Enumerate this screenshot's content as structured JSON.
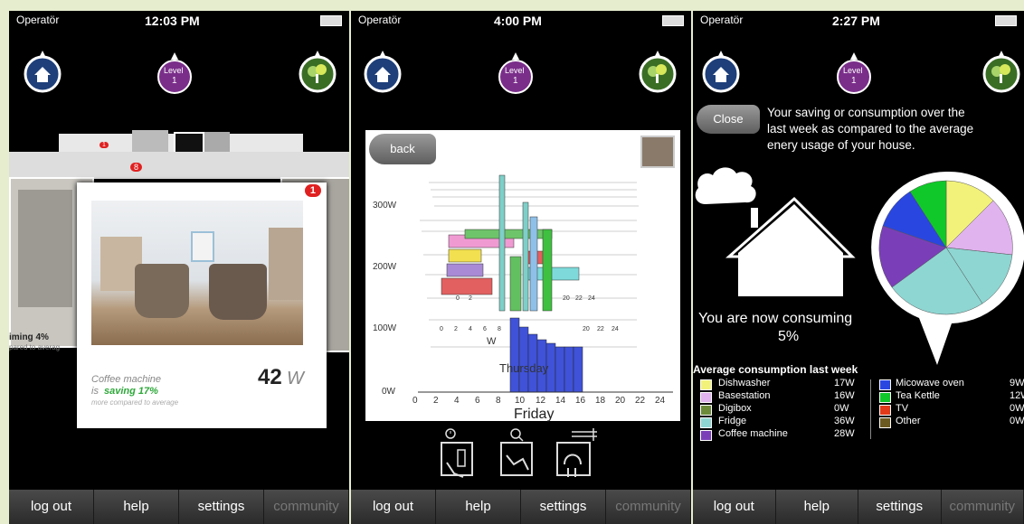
{
  "phones": [
    {
      "status": {
        "carrier": "Operatör",
        "time": "12:03 PM"
      },
      "level": {
        "label": "Level",
        "num": "1"
      },
      "card": {
        "badge": "1",
        "device": "Coffee machine",
        "is_word": "is",
        "saving": "saving 17%",
        "subtext": "more compared to average",
        "watts": "42",
        "unit": "W"
      },
      "bg_card": {
        "text": "iming 4%",
        "sub": "pared to averag"
      },
      "stack_badge": "8",
      "stack_badge2": "1",
      "tabs": [
        "log out",
        "help",
        "settings",
        "community"
      ]
    },
    {
      "status": {
        "carrier": "Operatör",
        "time": "4:00 PM"
      },
      "level": {
        "label": "Level",
        "num": "1"
      },
      "back_label": "back",
      "chart": {
        "y_ticks": [
          "300W",
          "200W",
          "100W",
          "0W"
        ],
        "x_ticks": [
          "0",
          "2",
          "4",
          "6",
          "8",
          "10",
          "12",
          "14",
          "16",
          "18",
          "20",
          "22",
          "24"
        ],
        "day_label": "Friday",
        "ghost_labels": [
          "W",
          "Thursday"
        ]
      },
      "tabs": [
        "log out",
        "help",
        "settings",
        "community"
      ]
    },
    {
      "status": {
        "carrier": "Operatör",
        "time": "2:27 PM"
      },
      "level": {
        "label": "Level",
        "num": "1"
      },
      "close_label": "Close",
      "description": [
        "Your saving or consumption over the",
        "last week as compared to the average",
        "enery usage of your house."
      ],
      "consuming_line1": "You are now consuming",
      "consuming_line2": "5%",
      "legend_title": "Average consumption last week",
      "legend_left": [
        {
          "name": "Dishwasher",
          "value": "17W",
          "color": "#f2f27a"
        },
        {
          "name": "Basestation",
          "value": "16W",
          "color": "#e0b2ee"
        },
        {
          "name": "Digibox",
          "value": "0W",
          "color": "#6c8a3a"
        },
        {
          "name": "Fridge",
          "value": "36W",
          "color": "#8ed6d2"
        },
        {
          "name": "Coffee machine",
          "value": "28W",
          "color": "#7a3fb8"
        }
      ],
      "legend_right": [
        {
          "name": "Micowave oven",
          "value": "9W",
          "color": "#2a46e0"
        },
        {
          "name": "Tea Kettle",
          "value": "12W",
          "color": "#10c82a"
        },
        {
          "name": "TV",
          "value": "0W",
          "color": "#e03a1a"
        },
        {
          "name": "Other",
          "value": "0W",
          "color": "#6b5a22"
        }
      ],
      "tabs": [
        "log out",
        "help",
        "settings",
        "community"
      ]
    }
  ]
}
